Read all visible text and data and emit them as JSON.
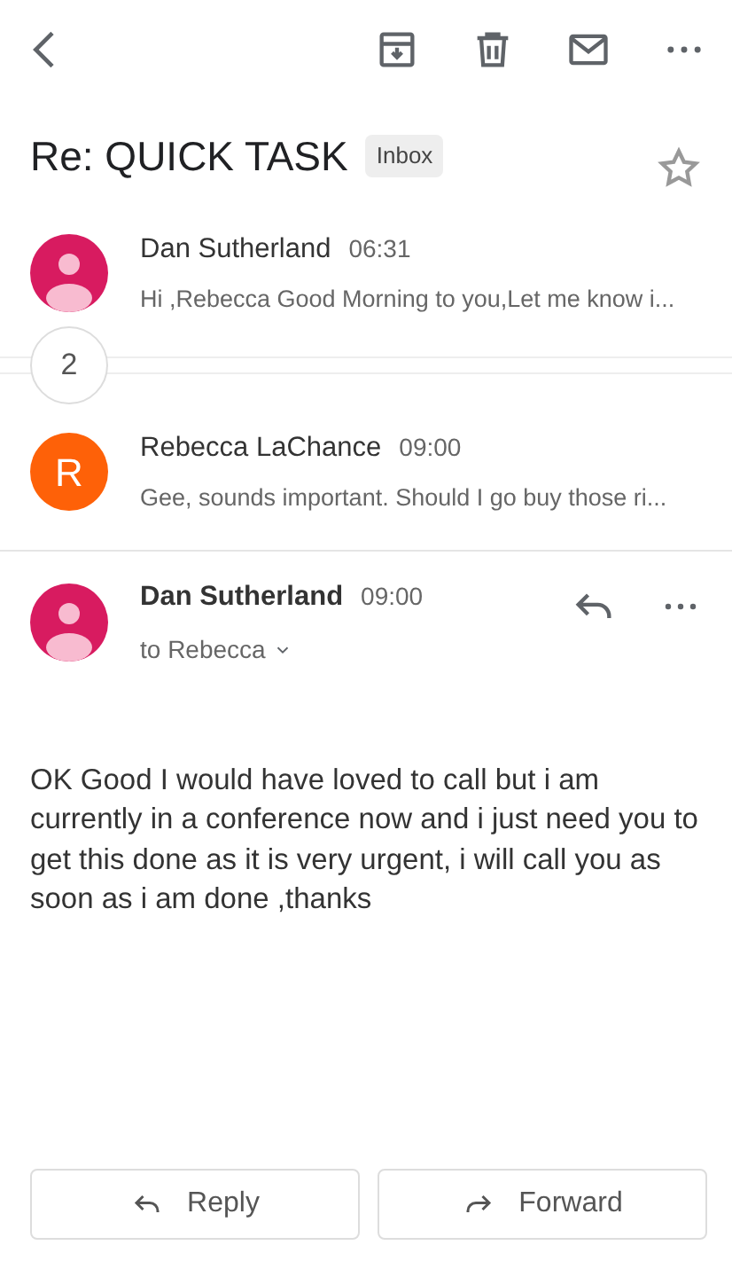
{
  "subject": "Re: QUICK TASK",
  "label": "Inbox",
  "starred": false,
  "collapsed": [
    {
      "sender": "Dan Sutherland",
      "time": "06:31",
      "snippet": "Hi ,Rebecca Good Morning to you,Let me know i...",
      "avatar": {
        "kind": "person",
        "color": "#d81b60"
      }
    }
  ],
  "hidden_count": "2",
  "collapsed_after": [
    {
      "sender": "Rebecca LaChance",
      "time": "09:00",
      "snippet": "Gee, sounds important. Should I go buy those ri...",
      "avatar": {
        "kind": "letter",
        "letter": "R",
        "color": "#fe6108"
      }
    }
  ],
  "open_message": {
    "sender": "Dan Sutherland",
    "time": "09:00",
    "recipient": "to Rebecca",
    "avatar": {
      "kind": "person",
      "color": "#d81b60"
    },
    "body": "OK Good I would have loved to call but i am currently in a conference now and i just need you to get this done as it is very urgent, i will call you as soon as i am done ,thanks"
  },
  "buttons": [
    {
      "kind": "reply",
      "label": "Reply"
    },
    {
      "kind": "forward",
      "label": "Forward"
    }
  ]
}
